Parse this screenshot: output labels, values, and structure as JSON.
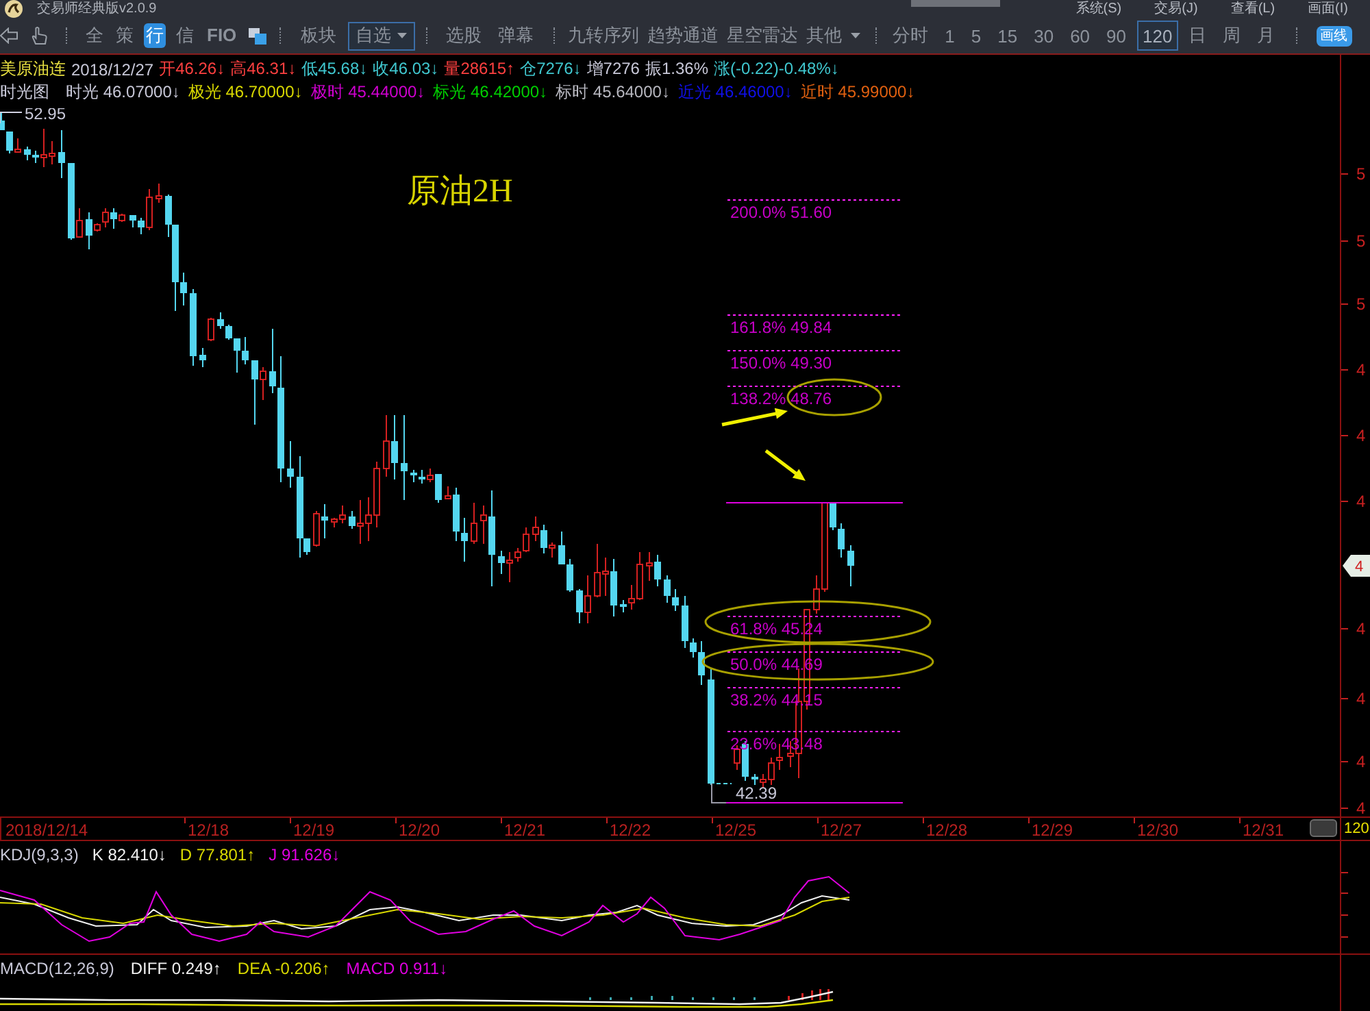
{
  "title_bar": {
    "title": "交易师经典版v2.0.9",
    "menus": [
      "系统(S)",
      "交易(J)",
      "查看(L)",
      "画面(I)"
    ]
  },
  "toolbar": {
    "views": [
      {
        "label": "全",
        "selected": false
      },
      {
        "label": "策",
        "selected": false
      },
      {
        "label": "行",
        "selected": true
      },
      {
        "label": "信",
        "selected": false
      },
      {
        "label": "FIO",
        "selected": false
      }
    ],
    "lists": [
      {
        "label": "板块",
        "kind": "plain",
        "selected": false
      },
      {
        "label": "自选",
        "kind": "dropdown",
        "selected": true
      }
    ],
    "tools": [
      {
        "label": "选股"
      },
      {
        "label": "弹幕"
      }
    ],
    "studies": [
      {
        "label": "九转序列",
        "kind": "plain"
      },
      {
        "label": "趋势通道",
        "kind": "plain"
      },
      {
        "label": "星空雷达",
        "kind": "plain"
      },
      {
        "label": "其他",
        "kind": "dropdown"
      }
    ],
    "periods": [
      {
        "label": "分时",
        "selected": false
      },
      {
        "label": "1",
        "selected": false
      },
      {
        "label": "5",
        "selected": false
      },
      {
        "label": "15",
        "selected": false
      },
      {
        "label": "30",
        "selected": false
      },
      {
        "label": "60",
        "selected": false
      },
      {
        "label": "90",
        "selected": false
      },
      {
        "label": "120",
        "selected": true
      },
      {
        "label": "日",
        "selected": false
      },
      {
        "label": "周",
        "selected": false
      },
      {
        "label": "月",
        "selected": false
      }
    ],
    "draw_button": {
      "label": "画线",
      "on": true
    }
  },
  "quote": {
    "symbol": "美原油连",
    "date": "2018/12/27",
    "fields": [
      {
        "text": "开46.26↓",
        "color": "#ff4040"
      },
      {
        "text": "高46.31↓",
        "color": "#ff4040"
      },
      {
        "text": "低45.68↓",
        "color": "#40c8d0"
      },
      {
        "text": "收46.03↓",
        "color": "#40c8d0"
      },
      {
        "text": "量28615↑",
        "color": "#ff4040"
      },
      {
        "text": "仓7276↓",
        "color": "#40c8d0"
      },
      {
        "text": "增7276",
        "color": "#c8c8d8"
      },
      {
        "text": "振1.36%",
        "color": "#c8c8d8"
      },
      {
        "text": "涨(-0.22)-0.48%↓",
        "color": "#40c8d0"
      }
    ]
  },
  "study_line": {
    "title": "时光图",
    "values": [
      {
        "text": "时光 46.07000↓",
        "color": "#c8c8d8"
      },
      {
        "text": "极光 46.70000↓",
        "color": "#d8d800"
      },
      {
        "text": "极时 45.44000↓",
        "color": "#d000d0"
      },
      {
        "text": "标光 46.42000↓",
        "color": "#00d000"
      },
      {
        "text": "标时 45.64000↓",
        "color": "#b8b8c0"
      },
      {
        "text": "近光 46.46000↓",
        "color": "#1010e8"
      },
      {
        "text": "近时 45.99000↓",
        "color": "#e06010"
      }
    ]
  },
  "price_chart": {
    "annotation": "原油2H",
    "high_label": "52.95",
    "low_label": "42.39",
    "fib_levels": [
      {
        "kind": "dotted",
        "label": "200.0% 51.60"
      },
      {
        "kind": "dotted",
        "label": "161.8% 49.84"
      },
      {
        "kind": "dotted",
        "label": "150.0% 49.30"
      },
      {
        "kind": "dotted",
        "label": "138.2% 48.76"
      },
      {
        "kind": "solid"
      },
      {
        "kind": "dotted",
        "label": "61.8% 45.24"
      },
      {
        "kind": "dotted",
        "label": "50.0% 44.69"
      },
      {
        "kind": "dotted",
        "label": "38.2% 44.15"
      },
      {
        "kind": "dotted",
        "label": "23.6% 43.48"
      },
      {
        "kind": "solid"
      }
    ],
    "price_axis": [
      "5",
      "5",
      "5",
      "4",
      "4",
      "4",
      "4",
      "4",
      "4",
      "4"
    ],
    "price_tag": "4"
  },
  "date_axis": {
    "dates": [
      "2018/12/14",
      "12/18",
      "12/19",
      "12/20",
      "12/21",
      "12/22",
      "12/25",
      "12/27",
      "12/28",
      "12/29",
      "12/30",
      "12/31"
    ],
    "period": "120"
  },
  "kdj": {
    "title": "KDJ(9,3,3)",
    "values": [
      {
        "text": "K 82.410↓",
        "color": "#f0f0f0"
      },
      {
        "text": "D 77.801↑",
        "color": "#d8d800"
      },
      {
        "text": "J 91.626↓",
        "color": "#e000e0"
      }
    ]
  },
  "macd": {
    "title": "MACD(12,26,9)",
    "values": [
      {
        "text": "DIFF 0.249↑",
        "color": "#f0f0f0"
      },
      {
        "text": "DEA -0.206↑",
        "color": "#d8d800"
      },
      {
        "text": "MACD 0.911↓",
        "color": "#e000e0"
      }
    ]
  }
}
